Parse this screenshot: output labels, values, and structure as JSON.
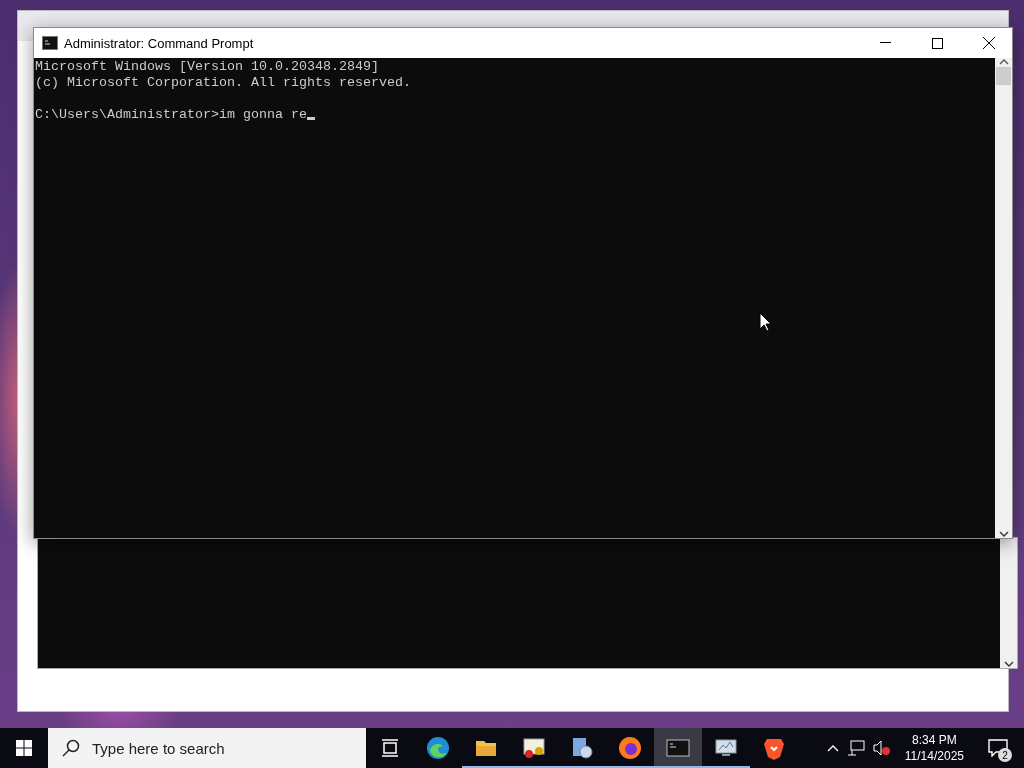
{
  "window": {
    "title": "Administrator: Command Prompt",
    "output": [
      "Microsoft Windows [Version 10.0.20348.2849]",
      "(c) Microsoft Corporation. All rights reserved."
    ],
    "prompt": "C:\\Users\\Administrator>im gonna re"
  },
  "taskbar": {
    "search": {
      "placeholder": "Type here to search"
    },
    "apps": [
      {
        "kind": "taskview",
        "running": false,
        "selected": false
      },
      {
        "kind": "edge",
        "running": false,
        "selected": false
      },
      {
        "kind": "folder",
        "running": true,
        "selected": false
      },
      {
        "kind": "certificate",
        "running": true,
        "selected": false
      },
      {
        "kind": "setup",
        "running": true,
        "selected": false
      },
      {
        "kind": "firefox",
        "running": true,
        "selected": false
      },
      {
        "kind": "terminal",
        "running": true,
        "selected": true
      },
      {
        "kind": "monitor",
        "running": true,
        "selected": false
      },
      {
        "kind": "brave",
        "running": false,
        "selected": false
      }
    ],
    "time": "8:34 PM",
    "date": "11/14/2025",
    "notifications": "2"
  }
}
